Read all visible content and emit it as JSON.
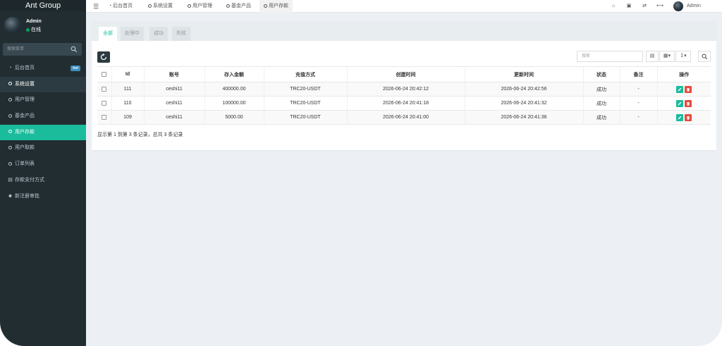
{
  "app": {
    "brand": "Ant Group"
  },
  "user_panel": {
    "name": "Admin",
    "status": "在线"
  },
  "sidebar": {
    "search_placeholder": "搜索菜单",
    "items": [
      {
        "label": "后台首页",
        "icon": "dashboard-icon",
        "badge": "hot"
      },
      {
        "label": "系统设置",
        "icon": "circle-icon"
      },
      {
        "label": "用户管理",
        "icon": "circle-icon"
      },
      {
        "label": "基金产品",
        "icon": "circle-icon"
      },
      {
        "label": "用户存款",
        "icon": "circle-icon",
        "active": true
      },
      {
        "label": "用户取款",
        "icon": "circle-icon"
      },
      {
        "label": "订单列表",
        "icon": "circle-icon"
      },
      {
        "label": "存款支付方式",
        "icon": "card-icon"
      },
      {
        "label": "新注册审批",
        "icon": "user-add-icon"
      }
    ]
  },
  "navbar": {
    "tabs": [
      {
        "label": "后台首页",
        "icon": "dashboard-icon"
      },
      {
        "label": "系统设置",
        "icon": "circle-icon"
      },
      {
        "label": "用户管理",
        "icon": "circle-icon"
      },
      {
        "label": "基金产品",
        "icon": "circle-icon"
      },
      {
        "label": "用户存款",
        "icon": "circle-icon",
        "active": true
      }
    ],
    "right_icons": [
      "home-icon",
      "trash-icon",
      "language-icon",
      "fullscreen-icon"
    ],
    "user": "Admin"
  },
  "panel": {
    "tabs": [
      "全部",
      "处理中",
      "成功",
      "失败"
    ],
    "search_placeholder": "搜索",
    "table": {
      "headers": [
        "Id",
        "账号",
        "存入金额",
        "充值方式",
        "创建时间",
        "更新时间",
        "状态",
        "备注",
        "操作"
      ],
      "rows": [
        {
          "id": "111",
          "account": "ceshi11",
          "amount": "400000.00",
          "method": "TRC20-USDT",
          "created": "2026-06-24 20:42:12",
          "updated": "2026-06-24 20:42:56",
          "status": "成功",
          "remark": "-"
        },
        {
          "id": "110",
          "account": "ceshi11",
          "amount": "100000.00",
          "method": "TRC20-USDT",
          "created": "2026-06-24 20:41:18",
          "updated": "2026-06-24 20:41:32",
          "status": "成功",
          "remark": "-"
        },
        {
          "id": "109",
          "account": "ceshi11",
          "amount": "5000.00",
          "method": "TRC20-USDT",
          "created": "2026-06-24 20:41:00",
          "updated": "2026-06-24 20:41:36",
          "status": "成功",
          "remark": "-"
        }
      ]
    },
    "pagination_text": "显示第 1 到第 3 条记录，总共 3 条记录"
  },
  "colors": {
    "accent": "#1abc9c",
    "sidebar_bg": "#222d32",
    "danger": "#e74c3c",
    "badge": "#3c8dbc"
  }
}
